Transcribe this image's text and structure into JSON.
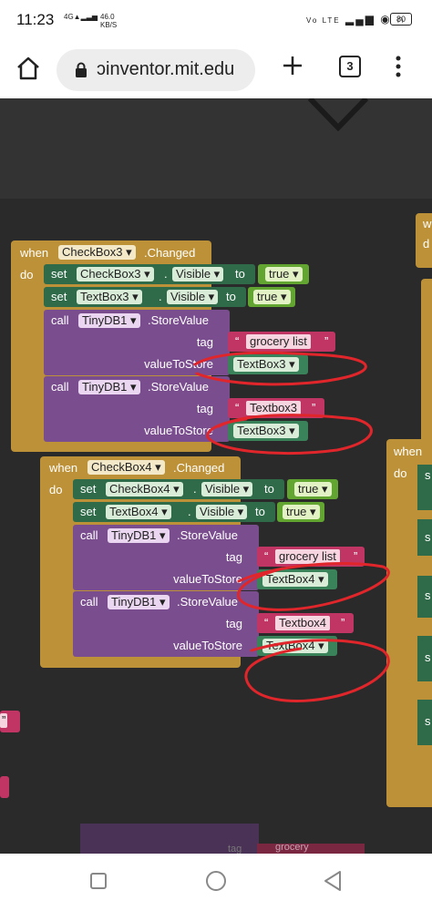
{
  "status_bar": {
    "time": "11:23",
    "network": "4G",
    "speed_value": "46.0",
    "speed_unit": "KB/S",
    "volte": "Vo LTE",
    "battery": "80"
  },
  "browser": {
    "url": "ɔinventor.mit.edu",
    "tab_count": "3"
  },
  "blocks": {
    "when": "when",
    "do": "do",
    "set": "set",
    "to": "to",
    "call": "call",
    "dot": ".",
    "visible": "Visible",
    "changed": ".Changed",
    "store_value": ".StoreValue",
    "tag": "tag",
    "value_to_store": "valueToStore",
    "true": "true",
    "tinydb": "TinyDB1",
    "quote_open": "“",
    "quote_close": "”",
    "group1": {
      "checkbox": "CheckBox3",
      "set1_component": "CheckBox3",
      "set2_component": "TextBox3",
      "tag1": "grocery list",
      "value1": "TextBox3",
      "tag2": "Textbox3",
      "value2": "TextBox3"
    },
    "group2": {
      "checkbox": "CheckBox4",
      "set1_component": "CheckBox4",
      "set2_component": "TextBox4",
      "tag1": "grocery list",
      "value1": "TextBox4",
      "tag2": "Textbox4",
      "value2": "TextBox4"
    },
    "partial_right": {
      "when": "w",
      "do": "d",
      "when2": "when",
      "do2": "do",
      "s": "s"
    },
    "partial_bottom": {
      "tag": "tag",
      "grocery": "grocery"
    },
    "partial_left": {
      "quote": "”"
    }
  },
  "colors": {
    "event_block": "#bd9137",
    "set_block": "#2f6b49",
    "call_block": "#7a4e8e",
    "text_block": "#c13564",
    "logic_block": "#62a631",
    "component_block": "#39825a",
    "annotation": "#e0262b"
  },
  "icons": {
    "home": "home-icon",
    "lock": "lock-icon",
    "new_tab": "plus-icon",
    "menu": "kebab-menu-icon",
    "recent_apps": "square-icon",
    "home_nav": "circle-icon",
    "back": "triangle-back-icon"
  }
}
